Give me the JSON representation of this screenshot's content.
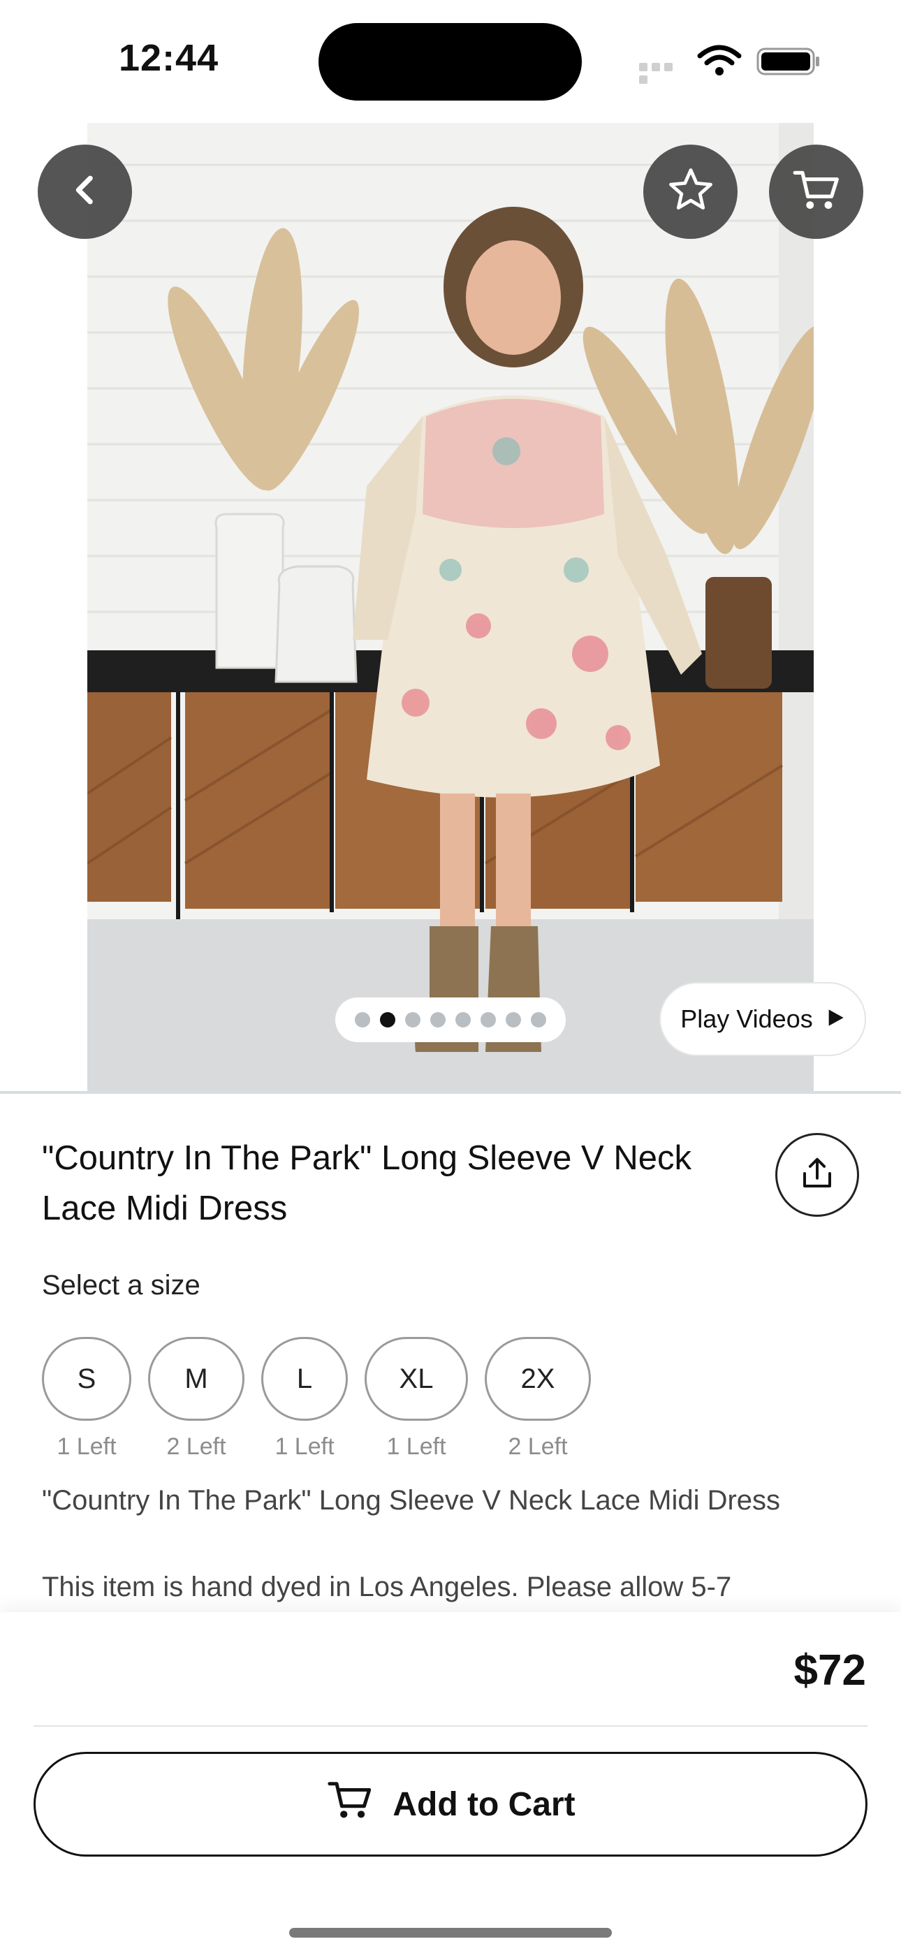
{
  "status_bar": {
    "time": "12:44"
  },
  "hero": {
    "image_desc": "product-photo",
    "dots_count": 8,
    "active_dot": 1,
    "play_videos_label": "Play Videos"
  },
  "product": {
    "title": "\"Country In The Park\" Long Sleeve V Neck Lace Midi Dress",
    "select_size_label": "Select a size",
    "sizes": [
      {
        "label": "S",
        "stock": "1 Left"
      },
      {
        "label": "M",
        "stock": "2 Left"
      },
      {
        "label": "L",
        "stock": "1 Left"
      },
      {
        "label": "XL",
        "stock": "1 Left"
      },
      {
        "label": "2X",
        "stock": "2 Left"
      }
    ],
    "description_title": "\"Country In The Park\" Long Sleeve V Neck Lace Midi Dress",
    "description_text": "This item is hand dyed in Los Angeles. Please allow 5-7"
  },
  "checkout": {
    "price": "$72",
    "add_to_cart_label": "Add to Cart"
  },
  "icons": {
    "back": "chevron-left-icon",
    "favorite": "star-icon",
    "cart": "cart-icon",
    "share": "share-icon",
    "play": "play-icon"
  }
}
